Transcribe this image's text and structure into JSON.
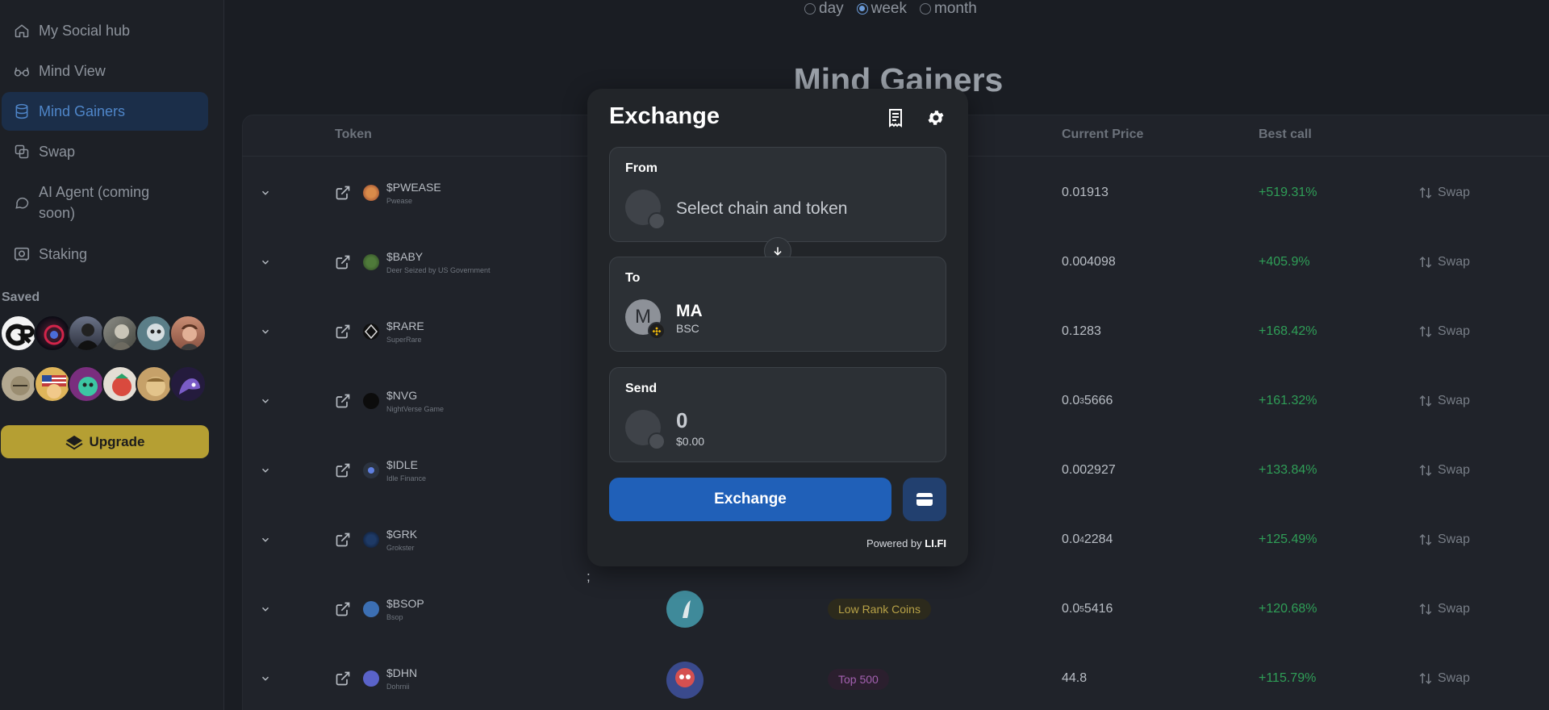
{
  "sidebar": {
    "items": [
      {
        "label": "My Social hub",
        "icon": "home-icon"
      },
      {
        "label": "Mind View",
        "icon": "glasses-icon"
      },
      {
        "label": "Mind Gainers",
        "icon": "database-icon",
        "active": true
      },
      {
        "label": "Swap",
        "icon": "swap-icon"
      },
      {
        "label": "AI Agent (coming soon)",
        "icon": "chat-icon"
      },
      {
        "label": "Staking",
        "icon": "safe-icon"
      }
    ],
    "saved_label": "Saved",
    "upgrade_label": "Upgrade"
  },
  "period": {
    "options": [
      "day",
      "week",
      "month"
    ],
    "selected": "week"
  },
  "page_title": "Mind Gainers",
  "table": {
    "columns": {
      "token": "Token",
      "current_price": "Current Price",
      "best_call": "Best call"
    },
    "swap_label": "Swap",
    "rows": [
      {
        "symbol": "$PWEASE",
        "name": "Pwease",
        "price": "0.01913",
        "best_call": "+519.31%"
      },
      {
        "symbol": "$BABY",
        "name": "Deer Seized by US Government",
        "price": "0.004098",
        "best_call": "+405.9%"
      },
      {
        "symbol": "$RARE",
        "name": "SuperRare",
        "price": "0.1283",
        "best_call": "+168.42%"
      },
      {
        "symbol": "$NVG",
        "name": "NightVerse Game",
        "price_main": "0.0",
        "price_sub": "3",
        "price_rest": "5666",
        "best_call": "+161.32%"
      },
      {
        "symbol": "$IDLE",
        "name": "Idle Finance",
        "price": "0.002927",
        "best_call": "+133.84%"
      },
      {
        "symbol": "$GRK",
        "name": "Grokster",
        "price_main": "0.0",
        "price_sub": "4",
        "price_rest": "2284",
        "best_call": "+125.49%"
      },
      {
        "symbol": "$BSOP",
        "name": "Bsop",
        "price_main": "0.0",
        "price_sub": "5",
        "price_rest": "5416",
        "best_call": "+120.68%",
        "category": "Low Rank Coins"
      },
      {
        "symbol": "$DHN",
        "name": "Dohrnii",
        "price": "44.8",
        "best_call": "+115.79%",
        "category": "Top 500"
      }
    ]
  },
  "stray_text": ";",
  "exchange": {
    "title": "Exchange",
    "from_label": "From",
    "from_placeholder": "Select chain and token",
    "to_label": "To",
    "to_token_letter": "M",
    "to_token": "MA",
    "to_chain": "BSC",
    "send_label": "Send",
    "send_amount": "0",
    "send_usd": "$0.00",
    "button_label": "Exchange",
    "powered_prefix": "Powered by",
    "powered_brand": "LI.FI"
  },
  "colors": {
    "accent": "#2060b8",
    "positive": "#2f9e57",
    "upgrade": "#b59f33",
    "active_nav": "#1b2e49"
  }
}
